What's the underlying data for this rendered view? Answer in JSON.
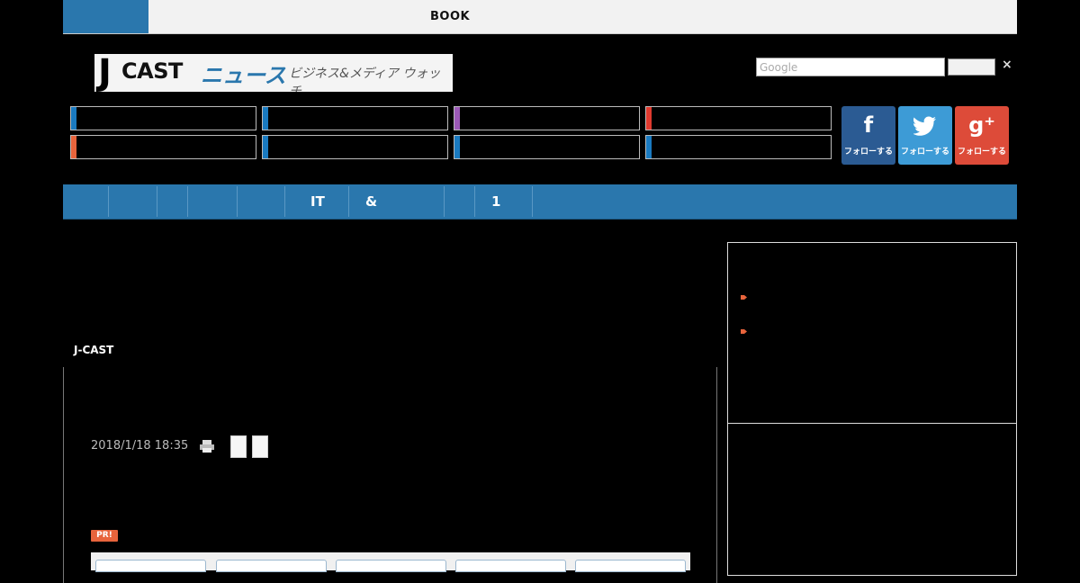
{
  "topbar": {
    "book_label": "BOOK"
  },
  "logo": {
    "j": "J",
    "cast": "CAST",
    "news": "ニュース",
    "tagline": "ビジネス&メディア ウォッチ"
  },
  "search": {
    "placeholder": "Google",
    "close_label": "×"
  },
  "category_colors": {
    "row1": [
      "#1a7ac0",
      "#1a7ac0",
      "#9b59b6",
      "#e03a2f"
    ],
    "row2": [
      "#e8643c",
      "#1a7ac0",
      "#1a7ac0",
      "#1a7ac0"
    ]
  },
  "social": {
    "facebook": {
      "glyph": "f",
      "label": "フォローする",
      "color": "#2b5b93"
    },
    "twitter": {
      "glyph": "🐦",
      "label": "フォローする",
      "color": "#3d9bd6"
    },
    "google_plus": {
      "glyph": "g⁺",
      "label": "フォローする",
      "color": "#dd4b39"
    }
  },
  "nav": {
    "items": [
      "",
      "",
      "",
      "",
      "IT",
      "&",
      "",
      "1"
    ],
    "color": "#2a77ad"
  },
  "breadcrumb": "J-CAST",
  "article": {
    "date": "2018/1/18 18:35",
    "pr_badge": "PR!"
  },
  "accent_colors": {
    "pr": "#e8643c",
    "bullet": "#e8643c"
  }
}
